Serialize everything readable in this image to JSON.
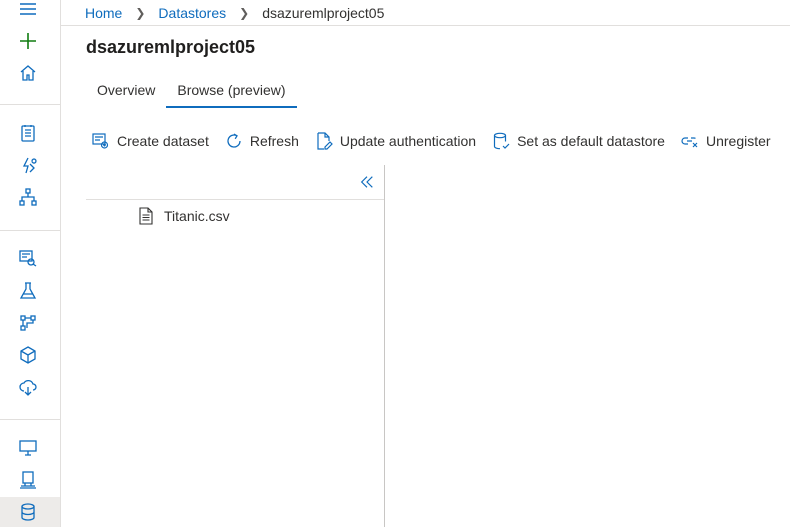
{
  "breadcrumb": {
    "home": "Home",
    "datastores": "Datastores",
    "current": "dsazuremlproject05"
  },
  "page": {
    "title": "dsazuremlproject05"
  },
  "tabs": [
    {
      "label": "Overview",
      "active": false
    },
    {
      "label": "Browse (preview)",
      "active": true
    }
  ],
  "toolbar": {
    "create_dataset": "Create dataset",
    "refresh": "Refresh",
    "update_authentication": "Update authentication",
    "set_default": "Set as default datastore",
    "unregister": "Unregister"
  },
  "files": [
    {
      "name": "Titanic.csv",
      "icon": "document-icon"
    }
  ],
  "rail": {
    "icons": [
      "hamburger-icon",
      "plus-icon",
      "home-icon",
      "notebook-icon",
      "automl-icon",
      "designer-icon",
      "datasets-icon",
      "experiments-icon",
      "pipelines-icon",
      "models-icon",
      "endpoints-icon",
      "compute-icon",
      "environments-icon",
      "datastores-icon"
    ],
    "selected": "datastores-icon"
  },
  "colors": {
    "accent": "#0f6cbd",
    "plus": "#107c10",
    "rail_selected": "#edebe9"
  }
}
